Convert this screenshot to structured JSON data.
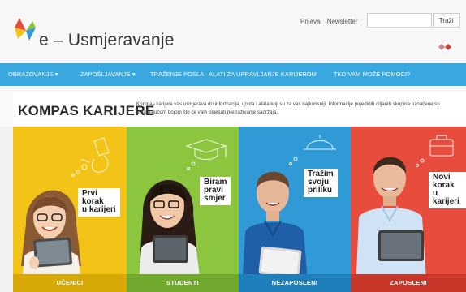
{
  "site": {
    "logo_text": "e – Usmjeravanje"
  },
  "top": {
    "login_label": "Prijava",
    "newsletter_label": "Newsletter",
    "search_placeholder": "",
    "search_button": "Traži"
  },
  "nav": {
    "items": [
      {
        "label": "OBRAZOVANJE ▾"
      },
      {
        "label": "ZAPOŠLJAVANJE ▾"
      },
      {
        "label": "TRAŽENJE POSLA"
      },
      {
        "label": "ALATI ZA UPRAVLJANJE KARIJEROM"
      },
      {
        "label": "TKO VAM MOŽE POMOĆI?"
      }
    ]
  },
  "intro": {
    "title": "KOMPAS KARIJERE",
    "description": "Kompas karijere vas usmjerava do informacija, uputa i alata koji su za vas najkorisniji. Informacije pojedinih ciljanih skupina označene su pripadajućom bojom što će vam olakšati pretraživanje sadržaja."
  },
  "panels": [
    {
      "tag_lines": [
        "Prvi",
        "korak",
        "u karijeri"
      ],
      "label": "UČENICI",
      "color": "#f4c317"
    },
    {
      "tag_lines": [
        "Biram",
        "pravi",
        "smjer"
      ],
      "label": "STUDENTI",
      "color": "#8cc63f"
    },
    {
      "tag_lines": [
        "Tražim",
        "svoju",
        "priliku"
      ],
      "label": "NEZAPOSLENI",
      "color": "#2f9ad6"
    },
    {
      "tag_lines": [
        "Novi",
        "korak",
        "u karijeri"
      ],
      "label": "ZAPOSLENI",
      "color": "#e74c3c"
    }
  ]
}
